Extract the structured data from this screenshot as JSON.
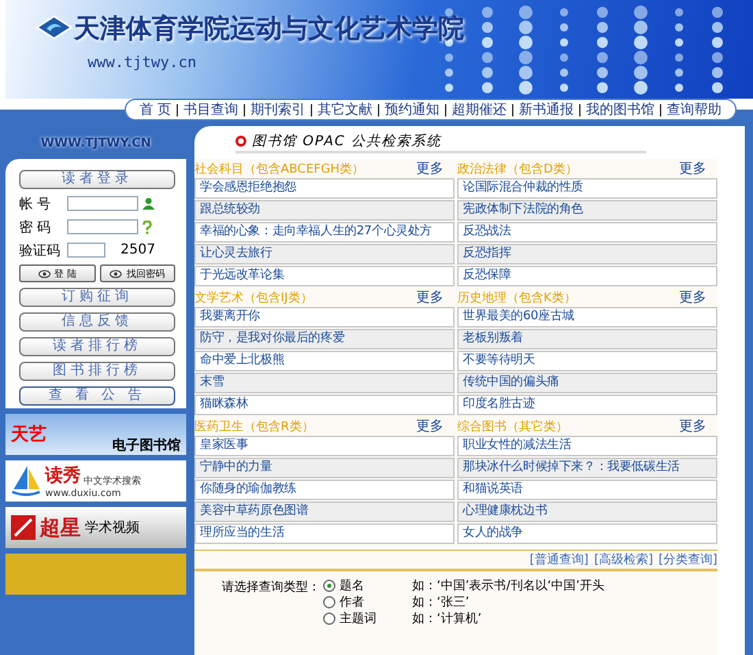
{
  "header": {
    "title": "天津体育学院运动与文化艺术学院",
    "url": "www.tjtwy.cn"
  },
  "nav": [
    "首 页",
    "书目查询",
    "期刊索引",
    "其它文献",
    "预约通知",
    "超期催还",
    "新书通报",
    "我的图书馆",
    "查询帮助"
  ],
  "sidebar": {
    "site_url": "WWW.TJTWY.CN",
    "login_title": "读者登录",
    "fields": [
      {
        "label": "帐 号",
        "kind": "account"
      },
      {
        "label": "密 码",
        "kind": "password"
      },
      {
        "label": "验证码",
        "kind": "captcha",
        "code": "2507"
      }
    ],
    "actions": [
      "登 陆",
      "找回密码"
    ],
    "buttons": [
      "订购征询",
      "信息反馈",
      "读者排行榜",
      "图书排行榜",
      "查 看 公 告"
    ],
    "banners": [
      {
        "kind": "tianyi",
        "texts": [
          "天艺",
          "电子图书馆"
        ]
      },
      {
        "kind": "duxiu",
        "texts": [
          "读秀",
          "中文学术搜索",
          "www.duxiu.com"
        ]
      },
      {
        "kind": "chaoxing",
        "texts": [
          "超星",
          "学术视频"
        ]
      },
      {
        "kind": "partial"
      }
    ]
  },
  "main": {
    "title": "图书馆 OPAC 公共检索系统",
    "sections": [
      {
        "title": "社会科目（包含ABCEFGH类）",
        "more": "更多",
        "books": [
          "学会感恩拒绝抱怨",
          "跟总统较劲",
          "幸福的心象：走向幸福人生的27个心灵处方",
          "让心灵去旅行",
          "于光远改革论集"
        ]
      },
      {
        "title": "政治法律（包含D类）",
        "more": "更多",
        "books": [
          "论国际混合仲裁的性质",
          "宪政体制下法院的角色",
          "反恐战法",
          "反恐指挥",
          "反恐保障"
        ]
      },
      {
        "title": "文学艺术（包含IJ类）",
        "more": "更多",
        "books": [
          "我要离开你",
          "防守，是我对你最后的疼爱",
          "命中爱上北极熊",
          "末雪",
          "猫眯森林"
        ]
      },
      {
        "title": "历史地理（包含K类）",
        "more": "更多",
        "books": [
          "世界最美的60座古城",
          "老板别叛着",
          "不要等待明天",
          "传统中国的偏头痛",
          "印度名胜古迹"
        ]
      },
      {
        "title": "医药卫生（包含R类）",
        "more": "更多",
        "books": [
          "皇家医事",
          "宁静中的力量",
          "你随身的瑜伽教练",
          "美容中草药原色图谱",
          "理所应当的生活"
        ]
      },
      {
        "title": "综合图书（其它类）",
        "more": "更多",
        "books": [
          "职业女性的减法生活",
          "那块冰什么时候掉下来？：我要低碳生活",
          "和猫说英语",
          "心理健康枕边书",
          "女人的战争"
        ]
      }
    ],
    "search_links": [
      "[普通查询]",
      "[高级检索]",
      "[分类查询]"
    ],
    "search": {
      "label": "请选择查询类型：",
      "options": [
        {
          "label": "题名",
          "selected": true,
          "example": "如：‘中国’表示书/刊名以‘中国’开头"
        },
        {
          "label": "作者",
          "selected": false,
          "example": "如：‘张三’"
        },
        {
          "label": "主题词",
          "selected": false,
          "example": "如：‘计算机’"
        }
      ]
    }
  }
}
